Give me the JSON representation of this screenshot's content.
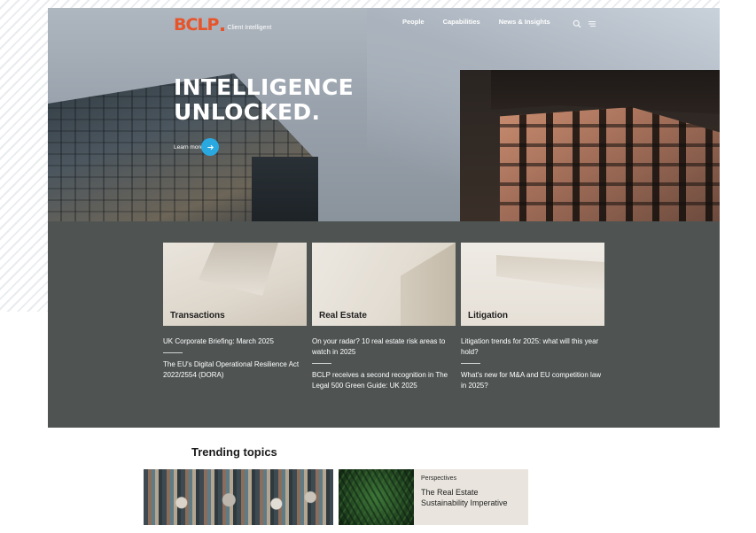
{
  "header": {
    "brand_logo": "BCLP",
    "brand_tagline": "Client Intelligent",
    "nav": [
      "People",
      "Capabilities",
      "News & Insights"
    ],
    "icons": [
      "search-icon",
      "menu-icon"
    ]
  },
  "hero": {
    "title_line1": "INTELLIGENCE",
    "title_line2": "UNLOCKED.",
    "cta_label": "Learn more",
    "cta_color": "#2aa8e0"
  },
  "colors": {
    "brand": "#e8542a",
    "band": "#4f5453"
  },
  "categories": [
    {
      "label": "Transactions",
      "articles": [
        "UK Corporate Briefing: March 2025",
        "The EU's Digital Operational Resilience Act 2022/2554 (DORA)"
      ]
    },
    {
      "label": "Real Estate",
      "articles": [
        "On your radar? 10 real estate risk areas to watch in 2025",
        "BCLP receives a second recognition in The Legal 500 Green Guide: UK 2025"
      ]
    },
    {
      "label": "Litigation",
      "articles": [
        "Litigation trends for 2025: what will this year hold?",
        "What's new for M&A and EU competition law in 2025?"
      ]
    }
  ],
  "trending": {
    "title": "Trending topics",
    "card": {
      "kicker": "Perspectives",
      "headline": "The Real Estate Sustainability Imperative"
    }
  }
}
